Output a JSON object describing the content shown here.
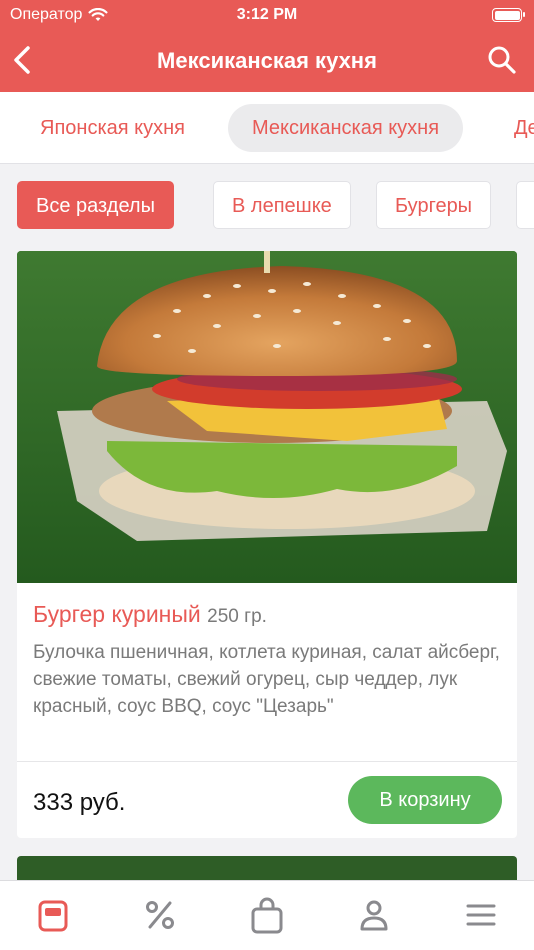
{
  "status_bar": {
    "carrier": "Оператор",
    "time": "3:12 PM"
  },
  "nav": {
    "title": "Мексиканская кухня",
    "back_icon": "chevron-left-icon",
    "search_icon": "search-icon"
  },
  "categories": [
    {
      "label": "Японская кухня",
      "active": false
    },
    {
      "label": "Мексиканская кухня",
      "active": true
    },
    {
      "label": "Де",
      "active": false
    }
  ],
  "sections": [
    {
      "label": "Все разделы",
      "active": true
    },
    {
      "label": "В лепешке",
      "active": false
    },
    {
      "label": "Бургеры",
      "active": false
    }
  ],
  "product": {
    "name": "Бургер куриный",
    "weight": "250 гр.",
    "description": "Булочка пшеничная, котлета куриная, салат айсберг, свежие томаты, свежий огурец, сыр чеддер, лук красный, соус BBQ, соус \"Цезарь\"",
    "price": "333 руб.",
    "cart_button": "В корзину"
  },
  "tabbar": [
    "menu-icon",
    "percent-icon",
    "bag-icon",
    "profile-icon",
    "hamburger-menu-icon"
  ],
  "colors": {
    "accent": "#e85a56",
    "success": "#5cb85c",
    "muted_text": "#7a7a7a"
  }
}
